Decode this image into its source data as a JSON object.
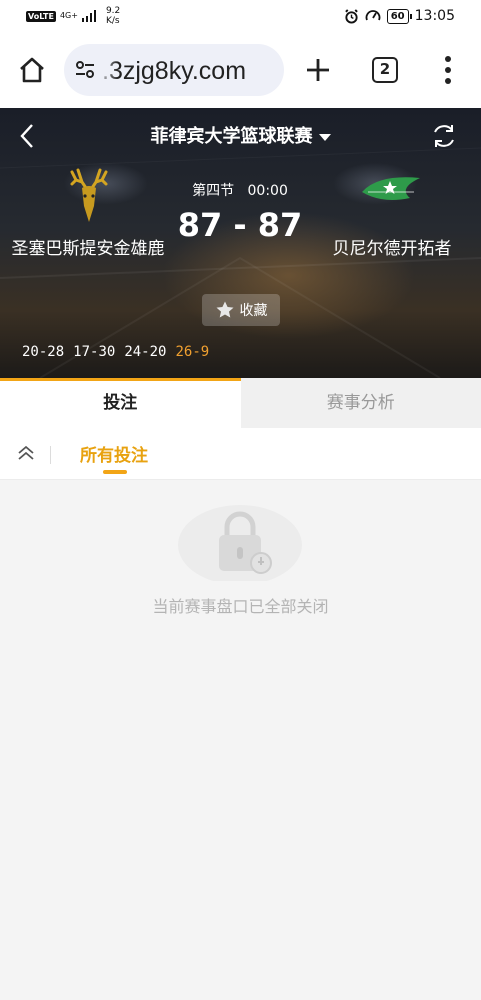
{
  "status_bar": {
    "volte": "VoLTE",
    "network": "4G+",
    "speed_value": "9.2",
    "speed_unit": "K/s",
    "battery": "60",
    "time": "13:05"
  },
  "browser": {
    "url": ".3zjg8ky.com",
    "tab_count": "2"
  },
  "match": {
    "league": "菲律宾大学篮球联赛",
    "home_team": "圣塞巴斯提安金雄鹿",
    "away_team": "贝尼尔德开拓者",
    "period": "第四节",
    "clock": "00:00",
    "score": "87 - 87",
    "favorite_label": "收藏",
    "quarters": [
      "20-28",
      "17-30",
      "24-20",
      "26-9"
    ]
  },
  "tabs": {
    "bet": "投注",
    "analysis": "赛事分析"
  },
  "filter": {
    "all_bets": "所有投注"
  },
  "empty_state": {
    "message": "当前赛事盘口已全部关闭"
  },
  "colors": {
    "accent": "#f2a516",
    "live_quarter": "#f0a030"
  }
}
